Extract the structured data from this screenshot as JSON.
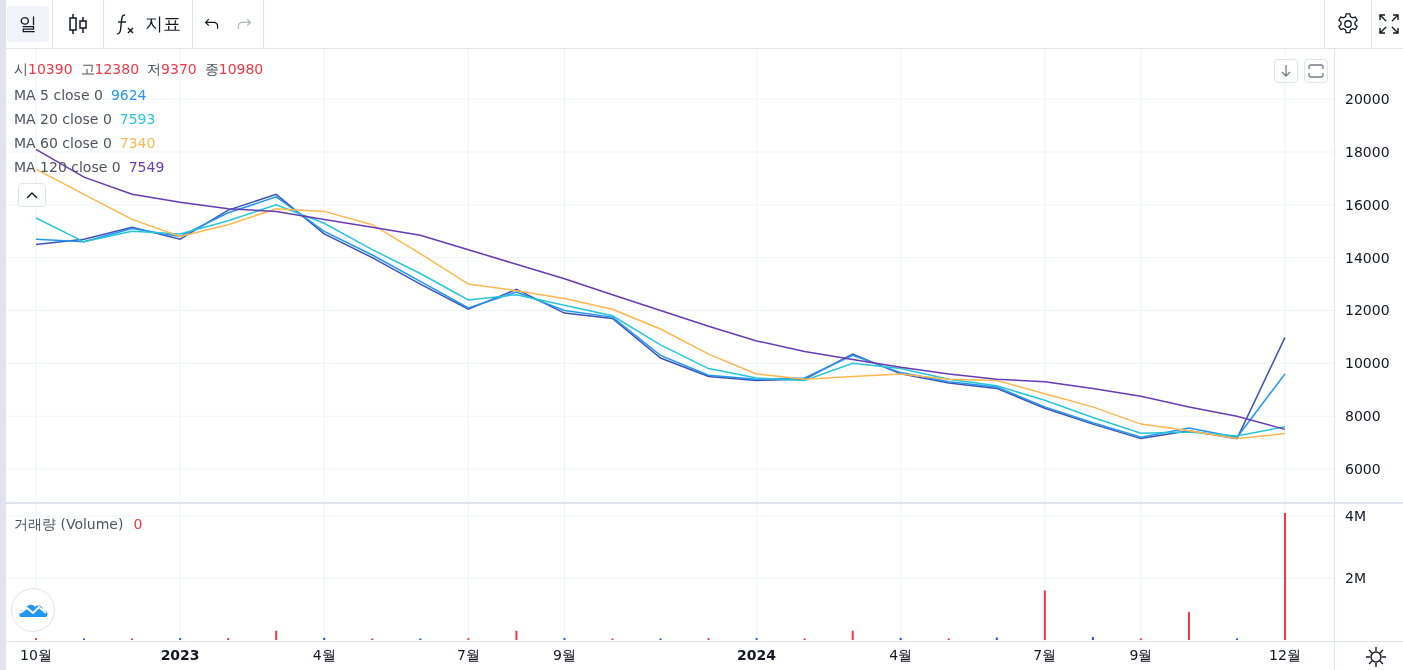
{
  "toolbar": {
    "interval": {
      "label": "일",
      "selected": true
    },
    "indicators_label": "지표",
    "undo_disabled": false,
    "redo_disabled": true
  },
  "ohlc": [
    {
      "label": "시",
      "value": "10390"
    },
    {
      "label": "고",
      "value": "12380"
    },
    {
      "label": "저",
      "value": "9370"
    },
    {
      "label": "종",
      "value": "10980"
    }
  ],
  "ma_legend": [
    {
      "name": "MA 5 close 0",
      "value": "9624",
      "color": "#2196f3"
    },
    {
      "name": "MA 20 close 0",
      "value": "7593",
      "color": "#26c6da"
    },
    {
      "name": "MA 60 close 0",
      "value": "7340",
      "color": "#ffb74d"
    },
    {
      "name": "MA 120 close 0",
      "value": "7549",
      "color": "#673ab7"
    }
  ],
  "price_chart": {
    "chart_data": {
      "type": "line",
      "grid": true,
      "categories": [
        null,
        null,
        null,
        null,
        null,
        null,
        null,
        null,
        null,
        null,
        null,
        null,
        null,
        null,
        null,
        null,
        null,
        null,
        null,
        null,
        null,
        null,
        null,
        null,
        null,
        null,
        null
      ],
      "ylim": [
        4750,
        21900
      ],
      "yticks": [
        6000,
        8000,
        10000,
        12000,
        14000,
        16000,
        18000,
        20000
      ],
      "series": [
        {
          "color": "#3f51b5",
          "values": [
            14500,
            14700,
            15150,
            14700,
            15800,
            16400,
            14900,
            14000,
            13000,
            12050,
            12800,
            11900,
            11700,
            10200,
            9500,
            9350,
            9400,
            10350,
            9600,
            9250,
            9050,
            8300,
            7700,
            7150,
            7450,
            7150,
            10980
          ]
        },
        {
          "color": "#2196f3",
          "values": [
            14700,
            14600,
            15100,
            14800,
            15700,
            16300,
            15000,
            14100,
            13100,
            12100,
            12700,
            12000,
            11750,
            10300,
            9550,
            9400,
            9450,
            10300,
            9650,
            9300,
            9100,
            8350,
            7750,
            7200,
            7550,
            7200,
            9600
          ]
        },
        {
          "color": "#26c6da",
          "values": [
            15500,
            14600,
            15000,
            14900,
            15400,
            16000,
            15300,
            14300,
            13400,
            12400,
            12600,
            12200,
            11800,
            10700,
            9800,
            9450,
            9350,
            10000,
            9800,
            9400,
            9150,
            8600,
            7950,
            7350,
            7400,
            7250,
            7600
          ]
        },
        {
          "color": "#ffb74d",
          "values": [
            17350,
            16400,
            15450,
            14800,
            15250,
            15850,
            15750,
            15250,
            14150,
            13000,
            12750,
            12450,
            12050,
            11300,
            10350,
            9600,
            9400,
            9500,
            9600,
            9400,
            9350,
            8850,
            8350,
            7700,
            7450,
            7150,
            7340
          ]
        },
        {
          "color": "#673ab7",
          "values": [
            18100,
            17050,
            16400,
            16100,
            15850,
            15750,
            15450,
            15150,
            14850,
            14300,
            13750,
            13200,
            12600,
            12000,
            11400,
            10850,
            10450,
            10150,
            9850,
            9600,
            9400,
            9300,
            9050,
            8750,
            8350,
            8000,
            7500
          ]
        }
      ]
    }
  },
  "volume_legend": {
    "name": "거래량 (Volume)",
    "value": "0"
  },
  "volume_chart": {
    "chart_data": {
      "type": "bar",
      "grid": true,
      "categories": [
        "10월",
        null,
        null,
        "2023",
        null,
        null,
        "4월",
        null,
        null,
        "7월",
        null,
        "9월",
        null,
        null,
        null,
        "2024",
        null,
        null,
        "4월",
        null,
        null,
        "7월",
        null,
        "9월",
        null,
        null,
        "12월"
      ],
      "ylim": [
        0,
        4390000
      ],
      "yticks": [
        {
          "value": 2000000,
          "label": "2M"
        },
        {
          "value": 4000000,
          "label": "4M"
        }
      ],
      "series": [
        {
          "color": "#f23645",
          "values": [
            60000,
            null,
            50000,
            null,
            60000,
            300000,
            null,
            50000,
            null,
            60000,
            300000,
            null,
            50000,
            null,
            60000,
            null,
            50000,
            300000,
            null,
            50000,
            null,
            1600000,
            null,
            50000,
            900000,
            null,
            4100000
          ]
        },
        {
          "color": "#1e53e5",
          "values": [
            null,
            50000,
            null,
            60000,
            null,
            null,
            70000,
            null,
            50000,
            null,
            null,
            60000,
            null,
            50000,
            null,
            60000,
            null,
            null,
            70000,
            null,
            80000,
            null,
            100000,
            null,
            null,
            50000,
            null
          ]
        }
      ]
    }
  }
}
